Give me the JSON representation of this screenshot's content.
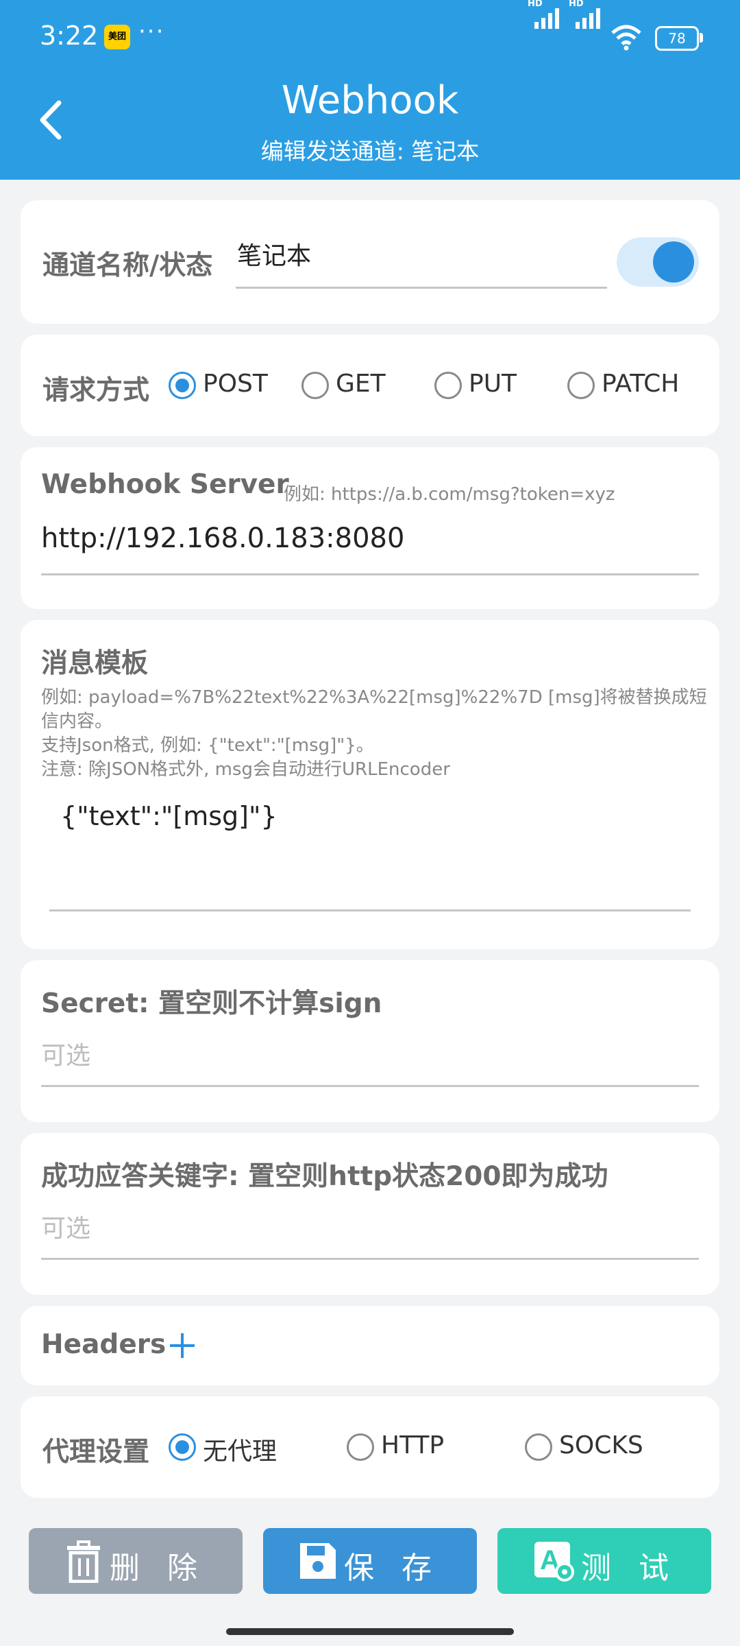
{
  "status_bar": {
    "time": "3:22",
    "app_badge": "美团",
    "more": "···",
    "battery": "78",
    "hd1": "HD",
    "hd2": "HD"
  },
  "header": {
    "title": "Webhook",
    "subtitle": "编辑发送通道: 笔记本"
  },
  "channel": {
    "label": "通道名称/状态",
    "name_value": "笔记本",
    "enabled": true
  },
  "request_method": {
    "label": "请求方式",
    "options": [
      "POST",
      "GET",
      "PUT",
      "PATCH"
    ],
    "selected": "POST"
  },
  "server": {
    "label": "Webhook Server",
    "hint": "例如: https://a.b.com/msg?token=xyz",
    "value": "http://192.168.0.183:8080"
  },
  "template": {
    "label": "消息模板",
    "hint1": "例如: payload=%7B%22text%22%3A%22[msg]%22%7D [msg]将被替换成短",
    "hint2": "信内容。",
    "hint3": "支持Json格式, 例如: {\"text\":\"[msg]\"}。",
    "hint4": "注意: 除JSON格式外, msg会自动进行URLEncoder",
    "value": "{\"text\":\"[msg]\"}"
  },
  "secret": {
    "label": "Secret: 置空则不计算sign",
    "placeholder": "可选"
  },
  "success_keyword": {
    "label": "成功应答关键字: 置空则http状态200即为成功",
    "placeholder": "可选"
  },
  "headers": {
    "label": "Headers",
    "add_icon": "plus-icon"
  },
  "proxy": {
    "label": "代理设置",
    "options": [
      "无代理",
      "HTTP",
      "SOCKS"
    ],
    "selected": "无代理"
  },
  "actions": {
    "delete": {
      "label": "删除",
      "color": "#9aa5b1",
      "icon": "trash-icon"
    },
    "save": {
      "label": "保存",
      "color": "#3a93d6",
      "icon": "floppy-icon"
    },
    "test": {
      "label": "测试",
      "color": "#2ecfb6",
      "icon": "test-icon"
    }
  },
  "colors": {
    "header": "#2b9ee3",
    "accent": "#2b8fe0",
    "background": "#f2f3f5"
  }
}
